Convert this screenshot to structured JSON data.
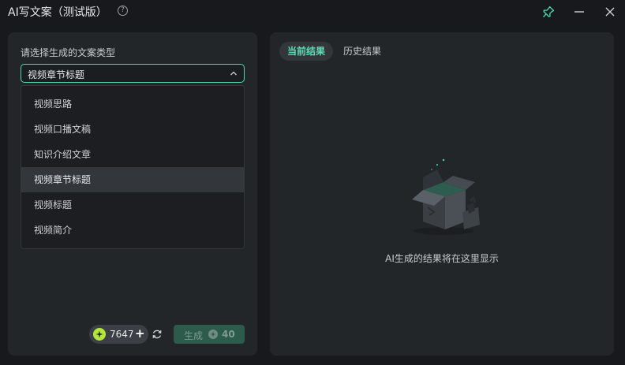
{
  "window": {
    "title": "AI写文案（测试版）",
    "help_glyph": "?"
  },
  "left": {
    "select_label": "请选择生成的文案类型",
    "selected_value": "视频章节标题",
    "options": [
      {
        "label": "视频思路",
        "selected": false
      },
      {
        "label": "视频口播文稿",
        "selected": false
      },
      {
        "label": "知识介绍文章",
        "selected": false
      },
      {
        "label": "视频章节标题",
        "selected": true
      },
      {
        "label": "视频标题",
        "selected": false
      },
      {
        "label": "视频简介",
        "selected": false
      }
    ],
    "credits": "7647",
    "credits_plus": "+",
    "generate_label": "生成",
    "generate_cost": "40"
  },
  "right": {
    "tabs": [
      {
        "label": "当前结果",
        "active": true
      },
      {
        "label": "历史结果",
        "active": false
      }
    ],
    "empty_text": "AI生成的结果将在这里显示"
  },
  "colors": {
    "accent": "#4fd8b0",
    "tab_active_text": "#58e0b6",
    "panel": "#232629",
    "background": "#17191c",
    "generate_button": "#2c5a4b",
    "credit_badge": "#b6e63e"
  }
}
